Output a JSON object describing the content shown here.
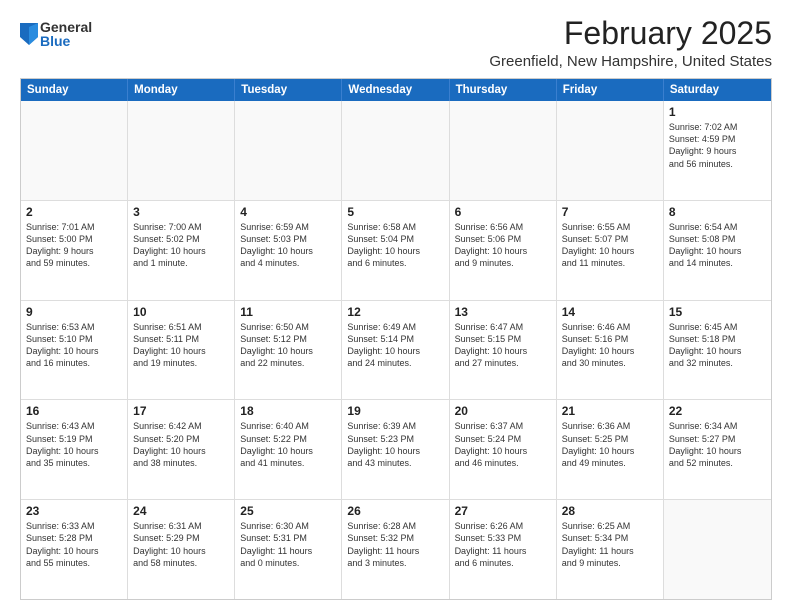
{
  "logo": {
    "general": "General",
    "blue": "Blue"
  },
  "title": "February 2025",
  "location": "Greenfield, New Hampshire, United States",
  "header_days": [
    "Sunday",
    "Monday",
    "Tuesday",
    "Wednesday",
    "Thursday",
    "Friday",
    "Saturday"
  ],
  "weeks": [
    [
      {
        "day": "",
        "text": "",
        "empty": true
      },
      {
        "day": "",
        "text": "",
        "empty": true
      },
      {
        "day": "",
        "text": "",
        "empty": true
      },
      {
        "day": "",
        "text": "",
        "empty": true
      },
      {
        "day": "",
        "text": "",
        "empty": true
      },
      {
        "day": "",
        "text": "",
        "empty": true
      },
      {
        "day": "1",
        "text": "Sunrise: 7:02 AM\nSunset: 4:59 PM\nDaylight: 9 hours\nand 56 minutes.",
        "empty": false
      }
    ],
    [
      {
        "day": "2",
        "text": "Sunrise: 7:01 AM\nSunset: 5:00 PM\nDaylight: 9 hours\nand 59 minutes.",
        "empty": false
      },
      {
        "day": "3",
        "text": "Sunrise: 7:00 AM\nSunset: 5:02 PM\nDaylight: 10 hours\nand 1 minute.",
        "empty": false
      },
      {
        "day": "4",
        "text": "Sunrise: 6:59 AM\nSunset: 5:03 PM\nDaylight: 10 hours\nand 4 minutes.",
        "empty": false
      },
      {
        "day": "5",
        "text": "Sunrise: 6:58 AM\nSunset: 5:04 PM\nDaylight: 10 hours\nand 6 minutes.",
        "empty": false
      },
      {
        "day": "6",
        "text": "Sunrise: 6:56 AM\nSunset: 5:06 PM\nDaylight: 10 hours\nand 9 minutes.",
        "empty": false
      },
      {
        "day": "7",
        "text": "Sunrise: 6:55 AM\nSunset: 5:07 PM\nDaylight: 10 hours\nand 11 minutes.",
        "empty": false
      },
      {
        "day": "8",
        "text": "Sunrise: 6:54 AM\nSunset: 5:08 PM\nDaylight: 10 hours\nand 14 minutes.",
        "empty": false
      }
    ],
    [
      {
        "day": "9",
        "text": "Sunrise: 6:53 AM\nSunset: 5:10 PM\nDaylight: 10 hours\nand 16 minutes.",
        "empty": false
      },
      {
        "day": "10",
        "text": "Sunrise: 6:51 AM\nSunset: 5:11 PM\nDaylight: 10 hours\nand 19 minutes.",
        "empty": false
      },
      {
        "day": "11",
        "text": "Sunrise: 6:50 AM\nSunset: 5:12 PM\nDaylight: 10 hours\nand 22 minutes.",
        "empty": false
      },
      {
        "day": "12",
        "text": "Sunrise: 6:49 AM\nSunset: 5:14 PM\nDaylight: 10 hours\nand 24 minutes.",
        "empty": false
      },
      {
        "day": "13",
        "text": "Sunrise: 6:47 AM\nSunset: 5:15 PM\nDaylight: 10 hours\nand 27 minutes.",
        "empty": false
      },
      {
        "day": "14",
        "text": "Sunrise: 6:46 AM\nSunset: 5:16 PM\nDaylight: 10 hours\nand 30 minutes.",
        "empty": false
      },
      {
        "day": "15",
        "text": "Sunrise: 6:45 AM\nSunset: 5:18 PM\nDaylight: 10 hours\nand 32 minutes.",
        "empty": false
      }
    ],
    [
      {
        "day": "16",
        "text": "Sunrise: 6:43 AM\nSunset: 5:19 PM\nDaylight: 10 hours\nand 35 minutes.",
        "empty": false
      },
      {
        "day": "17",
        "text": "Sunrise: 6:42 AM\nSunset: 5:20 PM\nDaylight: 10 hours\nand 38 minutes.",
        "empty": false
      },
      {
        "day": "18",
        "text": "Sunrise: 6:40 AM\nSunset: 5:22 PM\nDaylight: 10 hours\nand 41 minutes.",
        "empty": false
      },
      {
        "day": "19",
        "text": "Sunrise: 6:39 AM\nSunset: 5:23 PM\nDaylight: 10 hours\nand 43 minutes.",
        "empty": false
      },
      {
        "day": "20",
        "text": "Sunrise: 6:37 AM\nSunset: 5:24 PM\nDaylight: 10 hours\nand 46 minutes.",
        "empty": false
      },
      {
        "day": "21",
        "text": "Sunrise: 6:36 AM\nSunset: 5:25 PM\nDaylight: 10 hours\nand 49 minutes.",
        "empty": false
      },
      {
        "day": "22",
        "text": "Sunrise: 6:34 AM\nSunset: 5:27 PM\nDaylight: 10 hours\nand 52 minutes.",
        "empty": false
      }
    ],
    [
      {
        "day": "23",
        "text": "Sunrise: 6:33 AM\nSunset: 5:28 PM\nDaylight: 10 hours\nand 55 minutes.",
        "empty": false
      },
      {
        "day": "24",
        "text": "Sunrise: 6:31 AM\nSunset: 5:29 PM\nDaylight: 10 hours\nand 58 minutes.",
        "empty": false
      },
      {
        "day": "25",
        "text": "Sunrise: 6:30 AM\nSunset: 5:31 PM\nDaylight: 11 hours\nand 0 minutes.",
        "empty": false
      },
      {
        "day": "26",
        "text": "Sunrise: 6:28 AM\nSunset: 5:32 PM\nDaylight: 11 hours\nand 3 minutes.",
        "empty": false
      },
      {
        "day": "27",
        "text": "Sunrise: 6:26 AM\nSunset: 5:33 PM\nDaylight: 11 hours\nand 6 minutes.",
        "empty": false
      },
      {
        "day": "28",
        "text": "Sunrise: 6:25 AM\nSunset: 5:34 PM\nDaylight: 11 hours\nand 9 minutes.",
        "empty": false
      },
      {
        "day": "",
        "text": "",
        "empty": true
      }
    ]
  ]
}
